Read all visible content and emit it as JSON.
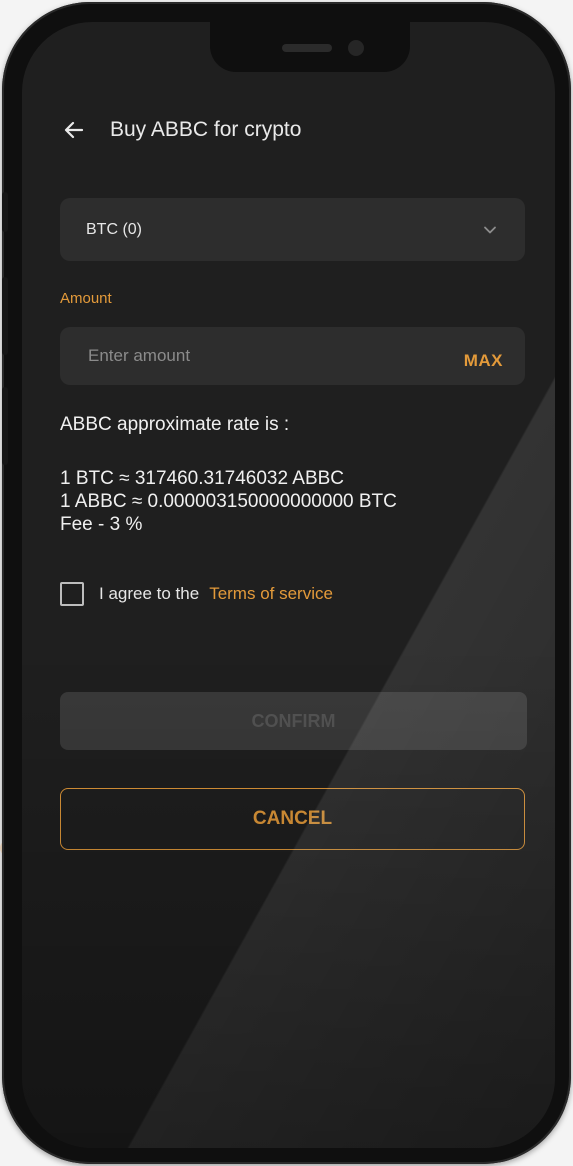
{
  "header": {
    "title": "Buy ABBC for crypto",
    "back_icon": "arrow-left-icon"
  },
  "currency_select": {
    "value": "BTC (0)",
    "icon": "chevron-down-icon"
  },
  "amount": {
    "label": "Amount",
    "placeholder": "Enter amount",
    "value": "",
    "max_label": "MAX"
  },
  "rate": {
    "heading": "ABBC approximate rate is :",
    "lines": [
      "1 BTC ≈ 317460.31746032 ABBC",
      "1 ABBC ≈ 0.000003150000000000 BTC",
      "Fee - 3 %"
    ]
  },
  "agreement": {
    "checked": false,
    "text": "I agree to the",
    "link_text": "Terms of service"
  },
  "buttons": {
    "confirm_label": "CONFIRM",
    "cancel_label": "CANCEL"
  },
  "colors": {
    "accent": "#e39a3a",
    "screen_bg": "#1f1f1f",
    "field_bg": "#2d2d2d",
    "disabled_btn": "#3a3a3a"
  }
}
